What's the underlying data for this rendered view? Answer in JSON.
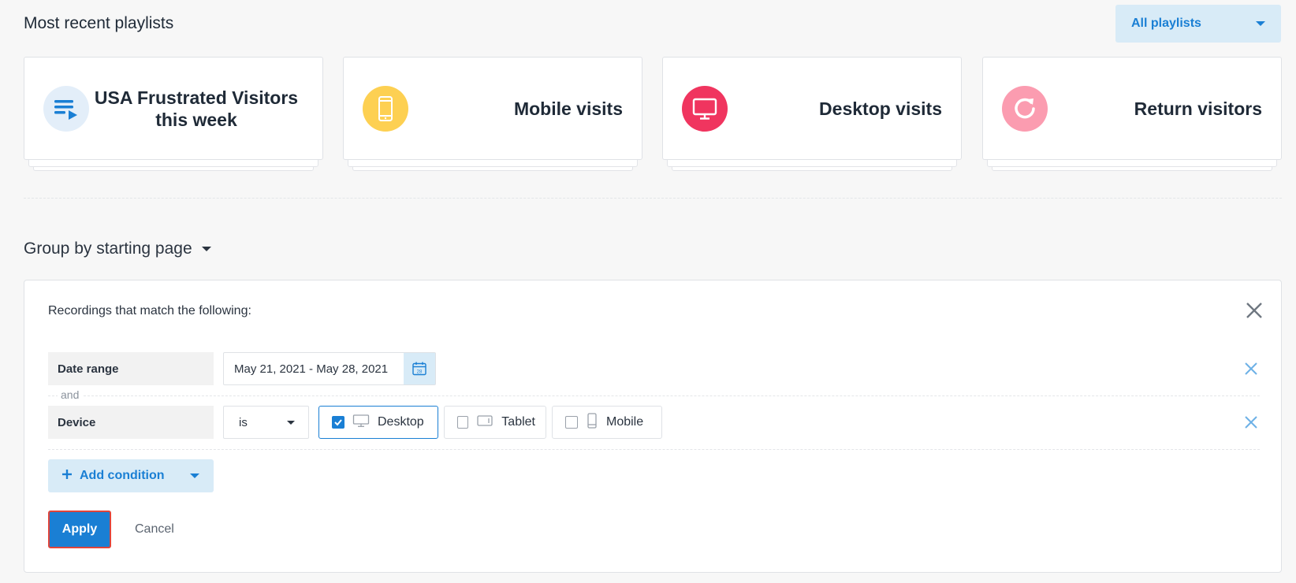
{
  "header": {
    "title": "Most recent playlists",
    "playlists_dropdown": "All playlists"
  },
  "cards": [
    {
      "title": "USA Frustrated Visitors this week",
      "icon": "playlist-icon",
      "color": "#e3eef9"
    },
    {
      "title": "Mobile visits",
      "icon": "mobile-icon",
      "color": "#fdd052"
    },
    {
      "title": "Desktop visits",
      "icon": "desktop-icon",
      "color": "#f0355f"
    },
    {
      "title": "Return visitors",
      "icon": "refresh-icon",
      "color": "#fb9cb0"
    }
  ],
  "group_by": {
    "label": "Group by starting page"
  },
  "filter": {
    "heading": "Recordings that match the following:",
    "date_range": {
      "label": "Date range",
      "value": "May 21, 2021 - May 28, 2021",
      "calendar_day": "28"
    },
    "joiner": "and",
    "device": {
      "label": "Device",
      "operator": "is",
      "options": [
        {
          "label": "Desktop",
          "checked": true
        },
        {
          "label": "Tablet",
          "checked": false
        },
        {
          "label": "Mobile",
          "checked": false
        }
      ]
    },
    "add_condition": "Add condition",
    "apply": "Apply",
    "cancel": "Cancel"
  },
  "colors": {
    "accent": "#1a7fd4",
    "accent_light": "#d8ebf7",
    "highlight_border": "#e0443a"
  }
}
